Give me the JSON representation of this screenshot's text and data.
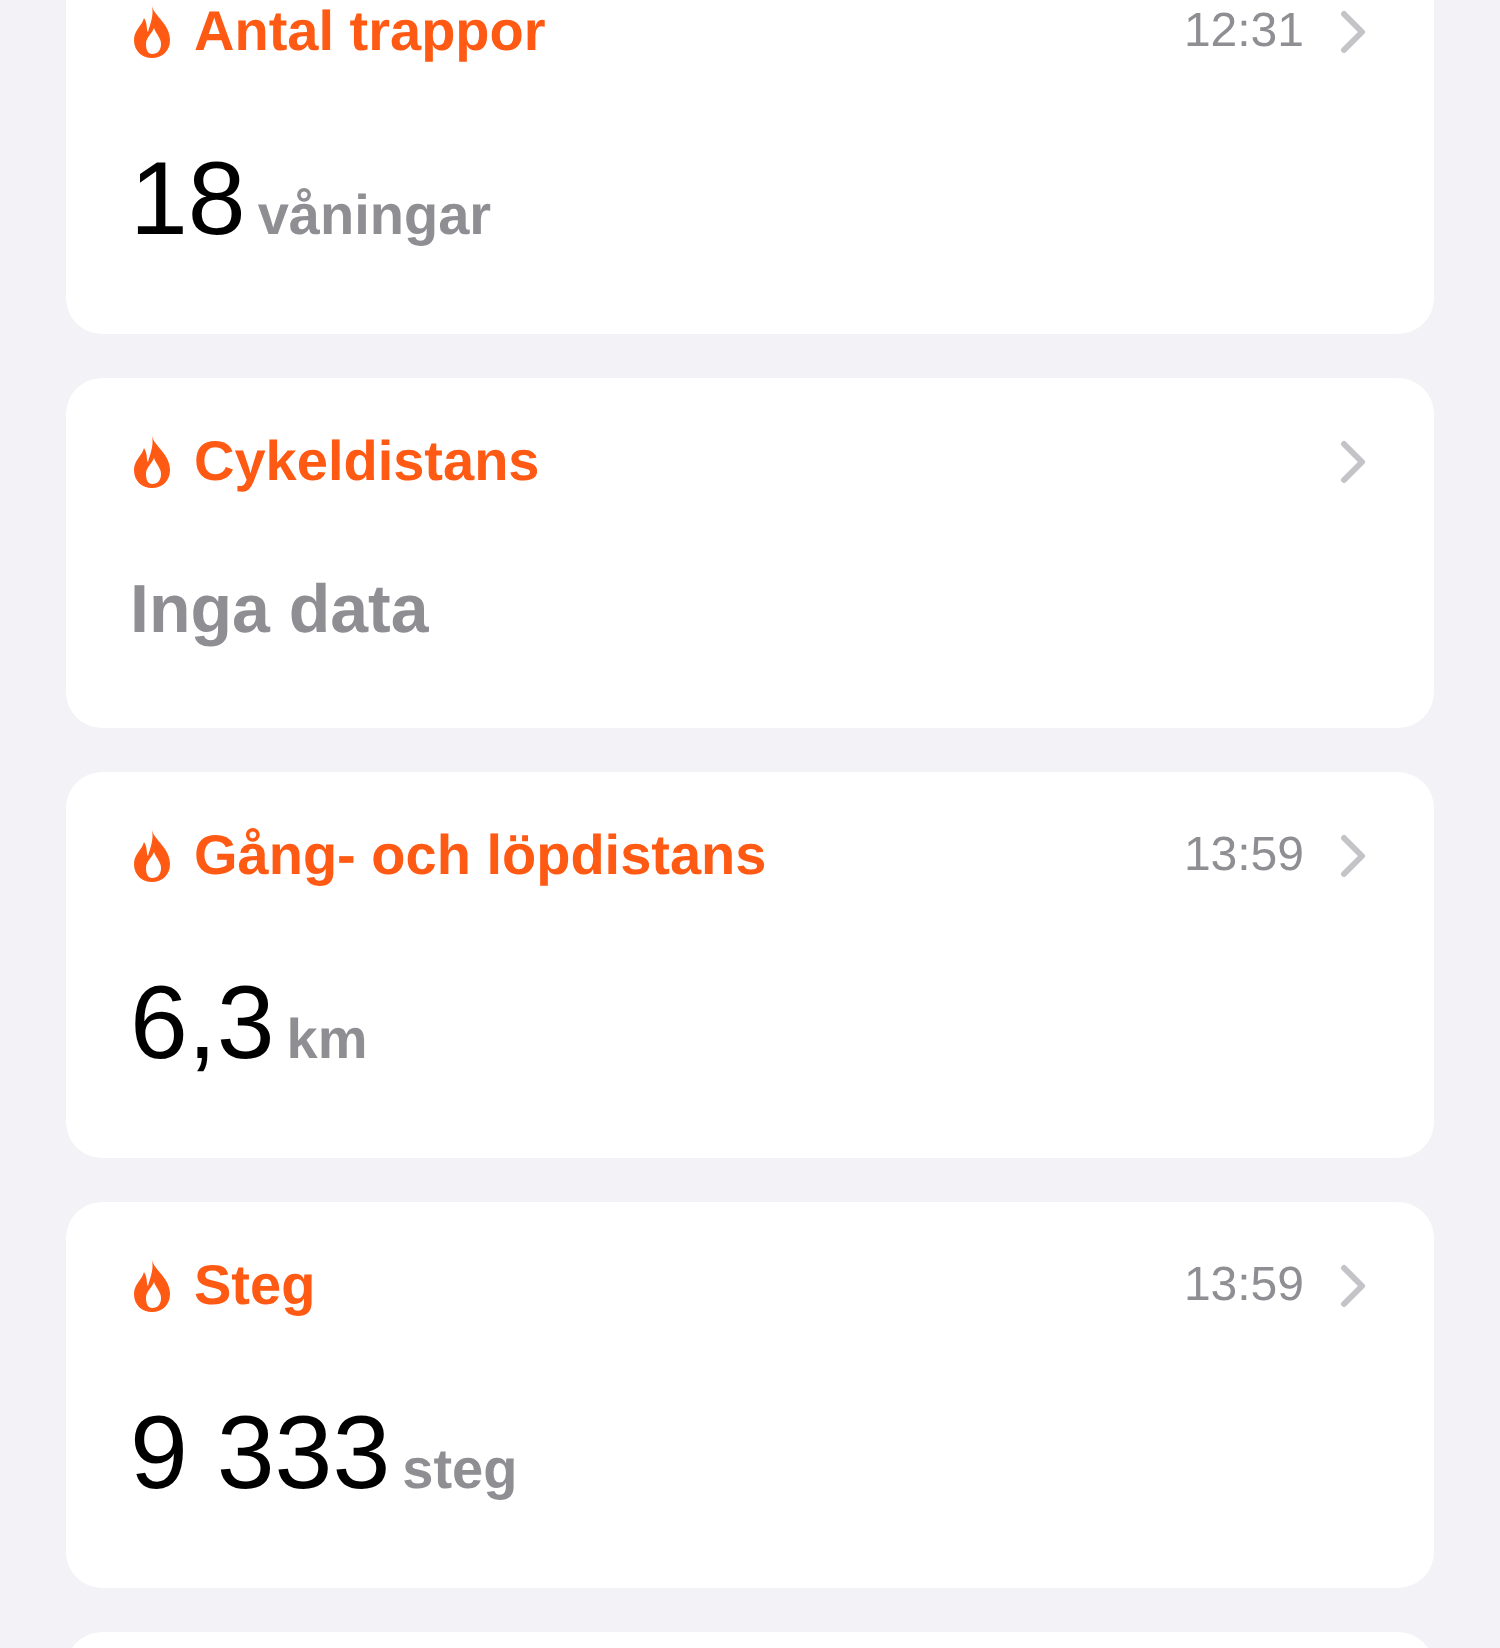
{
  "cards": [
    {
      "kind": "value",
      "title": "Antal trappor",
      "time": "12:31",
      "value": "18",
      "unit": "våningar"
    },
    {
      "kind": "no_data",
      "title": "Cykeldistans",
      "value": "Inga data"
    },
    {
      "kind": "value",
      "title": "Gång- och löpdistans",
      "time": "13:59",
      "value": "6,3",
      "unit": "km"
    },
    {
      "kind": "value",
      "title": "Steg",
      "time": "13:59",
      "value": "9 333",
      "unit": "steg"
    }
  ]
}
